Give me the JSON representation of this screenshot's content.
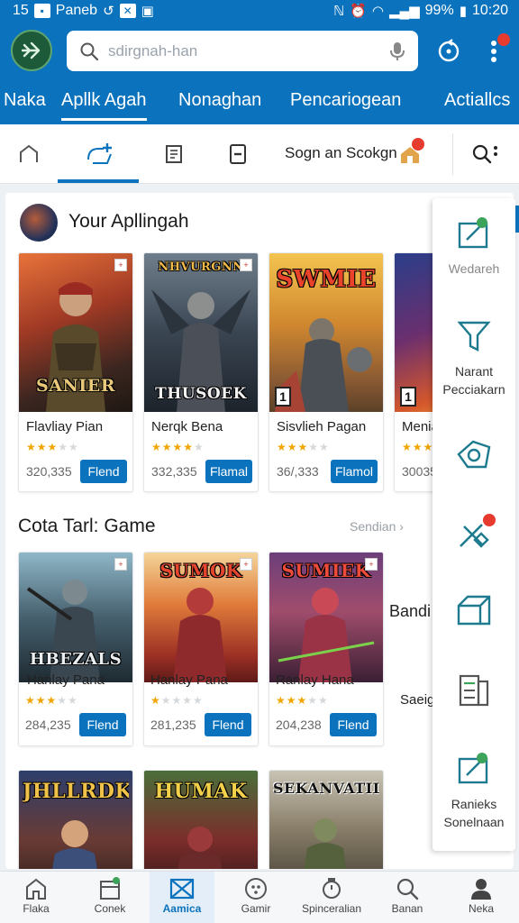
{
  "status_bar": {
    "time_left": "15",
    "carrier": "Paneb",
    "battery": "99%",
    "time": "10:20"
  },
  "search": {
    "placeholder": "sdirgnah-han"
  },
  "top_tabs": [
    "Naka",
    "Apllk Agah",
    "Nonaghan",
    "Pencariogean",
    "Actiallcs"
  ],
  "toolbar": {
    "promo_text": "Sogn an Scokgn"
  },
  "sections": [
    {
      "title": "Your Apllingah",
      "see_all": ""
    },
    {
      "title": "Cota Tarl: Game",
      "see_all": "Sendian"
    }
  ],
  "row1": [
    {
      "cover": "SANIER",
      "name": "Flavliay Pian",
      "count": "320,335",
      "button": "Flend",
      "stars": 3
    },
    {
      "cover": "THUSOEK",
      "cover_top": "NHVURGNN",
      "name": "Nerqk Bena",
      "count": "332,335",
      "button": "Flamal",
      "stars": 4,
      "badge": ""
    },
    {
      "cover": "SWMIE",
      "name": "Sisvlieh Pagan",
      "count": "36/,333",
      "button": "Flamol",
      "stars": 3,
      "badge": "1"
    },
    {
      "cover": "",
      "name": "Menia",
      "count": "30035",
      "button": "",
      "stars": 3,
      "badge": "1"
    }
  ],
  "row2": [
    {
      "cover": "HBEZALS",
      "name": "Hanlay Pana",
      "count": "284,235",
      "button": "Flend",
      "stars": 3
    },
    {
      "cover": "SUMOK",
      "name": "Hanlay Pana",
      "count": "281,235",
      "button": "Flend",
      "stars": 1
    },
    {
      "cover": "SUMIEK",
      "name": "Ranlay Hana",
      "count": "204,238",
      "button": "Flend",
      "stars": 3
    }
  ],
  "side_labels": {
    "bandi": "Bandi",
    "saeig": "Saeig"
  },
  "row3": [
    {
      "cover": "JHLLRDK"
    },
    {
      "cover": "HUMAK"
    },
    {
      "cover": "SEKANVATIL"
    }
  ],
  "rail": [
    {
      "label": "Wedareh"
    },
    {
      "label": "Narant\nPecciakarn"
    },
    {
      "label": ""
    },
    {
      "label": ""
    },
    {
      "label": ""
    },
    {
      "label": ""
    },
    {
      "label": "Ranieks\nSonelnaan"
    }
  ],
  "bottom_nav": [
    "Flaka",
    "Conek",
    "Aamica",
    "Gamir",
    "Spinceralian",
    "Banan",
    "Neka"
  ],
  "colors": {
    "primary": "#0b73bd",
    "accent_red": "#e63b2e",
    "star": "#f0a500",
    "rail_icon": "#1e7b8f"
  }
}
